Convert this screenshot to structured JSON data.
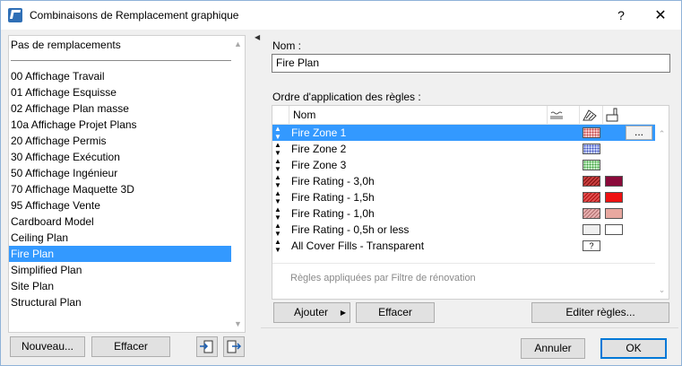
{
  "window": {
    "title": "Combinaisons de Remplacement graphique",
    "help": "?",
    "close": "✕"
  },
  "left": {
    "header_item": "Pas de remplacements",
    "items": [
      {
        "label": "00 Affichage Travail"
      },
      {
        "label": "01 Affichage Esquisse"
      },
      {
        "label": "02 Affichage Plan masse"
      },
      {
        "label": "10a Affichage Projet Plans"
      },
      {
        "label": "20 Affichage Permis"
      },
      {
        "label": "30 Affichage Exécution"
      },
      {
        "label": "50 Affichage Ingénieur"
      },
      {
        "label": "70 Affichage Maquette 3D"
      },
      {
        "label": "95 Affichage Vente"
      },
      {
        "label": "Cardboard Model"
      },
      {
        "label": "Ceiling Plan"
      },
      {
        "label": "Fire Plan"
      },
      {
        "label": "Simplified Plan"
      },
      {
        "label": "Site Plan"
      },
      {
        "label": "Structural Plan"
      }
    ],
    "selected_index": 11,
    "new_button": "Nouveau...",
    "delete_button": "Effacer"
  },
  "right": {
    "name_label": "Nom :",
    "name_value": "Fire Plan",
    "rules_label": "Ordre d'application des règles :",
    "column_name": "Nom",
    "rules": [
      {
        "name": "Fire Zone 1",
        "fill": "#f7c8c8",
        "pattern": "dots-red",
        "selected": true
      },
      {
        "name": "Fire Zone 2",
        "fill": "#c8d4f7",
        "pattern": "dots-blue"
      },
      {
        "name": "Fire Zone 3",
        "fill": "#c8f0c8",
        "pattern": "dots-green"
      },
      {
        "name": "Fire Rating - 3,0h",
        "fill": "#c84040",
        "pattern": "hatch-dark",
        "second": "#8a0a3a"
      },
      {
        "name": "Fire Rating - 1,5h",
        "fill": "#e05050",
        "pattern": "hatch-red",
        "second": "#ee1111"
      },
      {
        "name": "Fire Rating - 1,0h",
        "fill": "#e8b0b0",
        "pattern": "hatch-light",
        "second": "#e8a8a0"
      },
      {
        "name": "Fire Rating - 0,5h or less",
        "fill": "#f0f0f0",
        "pattern": "plain",
        "second": "#ffffff"
      },
      {
        "name": "All Cover Fills - Transparent",
        "fill": "#ffffff",
        "pattern": "question",
        "mark": "?"
      }
    ],
    "ellipsis": "...",
    "renovation_text": "Règles appliquées par Filtre de rénovation",
    "add_button": "Ajouter",
    "delete_button": "Effacer",
    "edit_rules_button": "Editer règles..."
  },
  "footer": {
    "cancel": "Annuler",
    "ok": "OK"
  },
  "colors": {
    "selection": "#3399ff",
    "accent": "#0078d7"
  }
}
